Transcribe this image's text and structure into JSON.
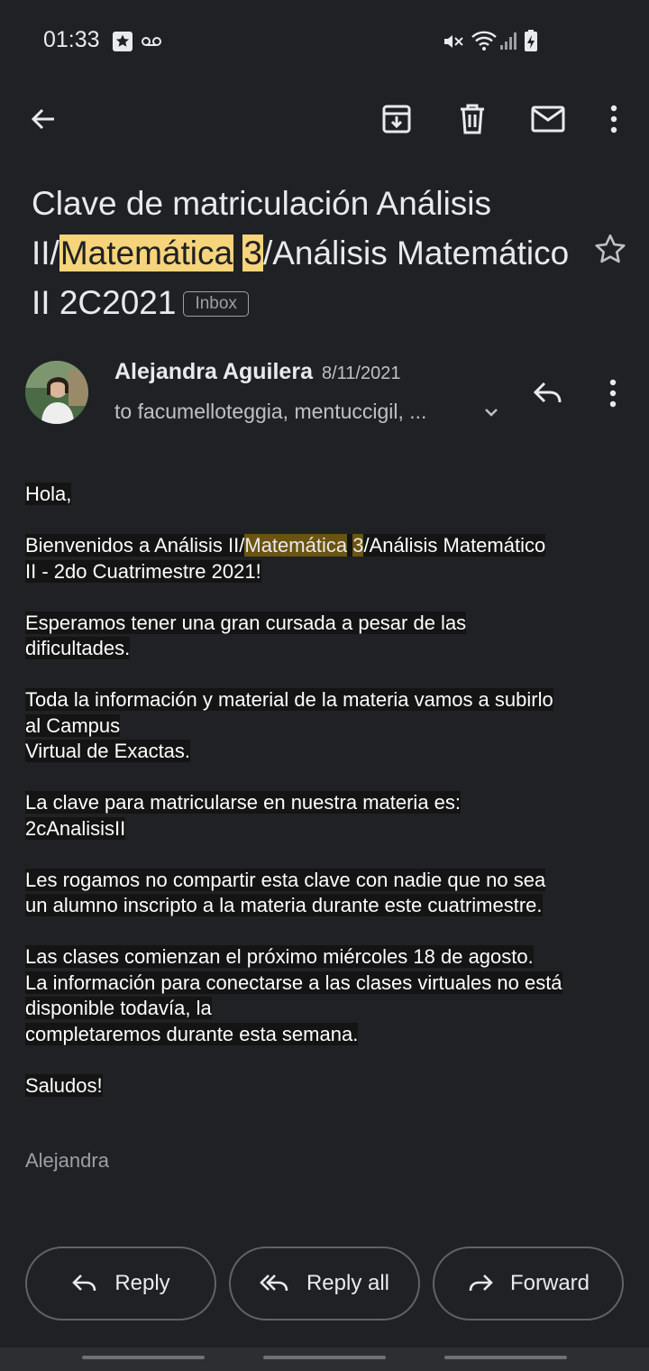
{
  "status": {
    "time": "01:33"
  },
  "subject": {
    "part1": "Clave de matriculación Análisis II/",
    "highlight1": "Matemática",
    "space": " ",
    "highlight2": "3",
    "part2": "/Análisis Matemático II 2C2021",
    "label": "Inbox"
  },
  "sender": {
    "name": "Alejandra Aguilera",
    "date": "8/11/2021",
    "recipients": "to facumelloteggia, mentuccigil, ..."
  },
  "body": {
    "greeting": "Hola,",
    "p1_a": "Bienvenidos a Análisis II/",
    "p1_hl1": "Matemática",
    "p1_hl2": "3",
    "p1_b": "/Análisis Matemático",
    "p1_c": "II - 2do Cuatrimestre 2021!",
    "p2_a": "Esperamos tener una gran cursada a pesar de las",
    "p2_b": "dificultades.",
    "p3_a": "Toda la información y material de la materia vamos a subirlo",
    "p3_b": "al Campus",
    "p3_c": "Virtual de Exactas.",
    "p4_a": "La clave para matricularse en nuestra materia es:",
    "p4_b": "2cAnalisisII",
    "p5_a": "Les rogamos no compartir esta clave con nadie que no sea",
    "p5_b": "un alumno inscripto a la materia durante este cuatrimestre.",
    "p6_a": "Las clases comienzan el próximo miércoles 18 de agosto.",
    "p6_b": "La información para conectarse a las clases virtuales no está",
    "p6_c": "disponible todavía, la",
    "p6_d": "completaremos durante esta semana.",
    "closing": "Saludos!",
    "signature": "Alejandra"
  },
  "actions": {
    "reply": "Reply",
    "reply_all": "Reply all",
    "forward": "Forward"
  },
  "colors": {
    "background": "#202124",
    "highlight": "#f6d47b",
    "highlight_dark": "#6b5410"
  }
}
